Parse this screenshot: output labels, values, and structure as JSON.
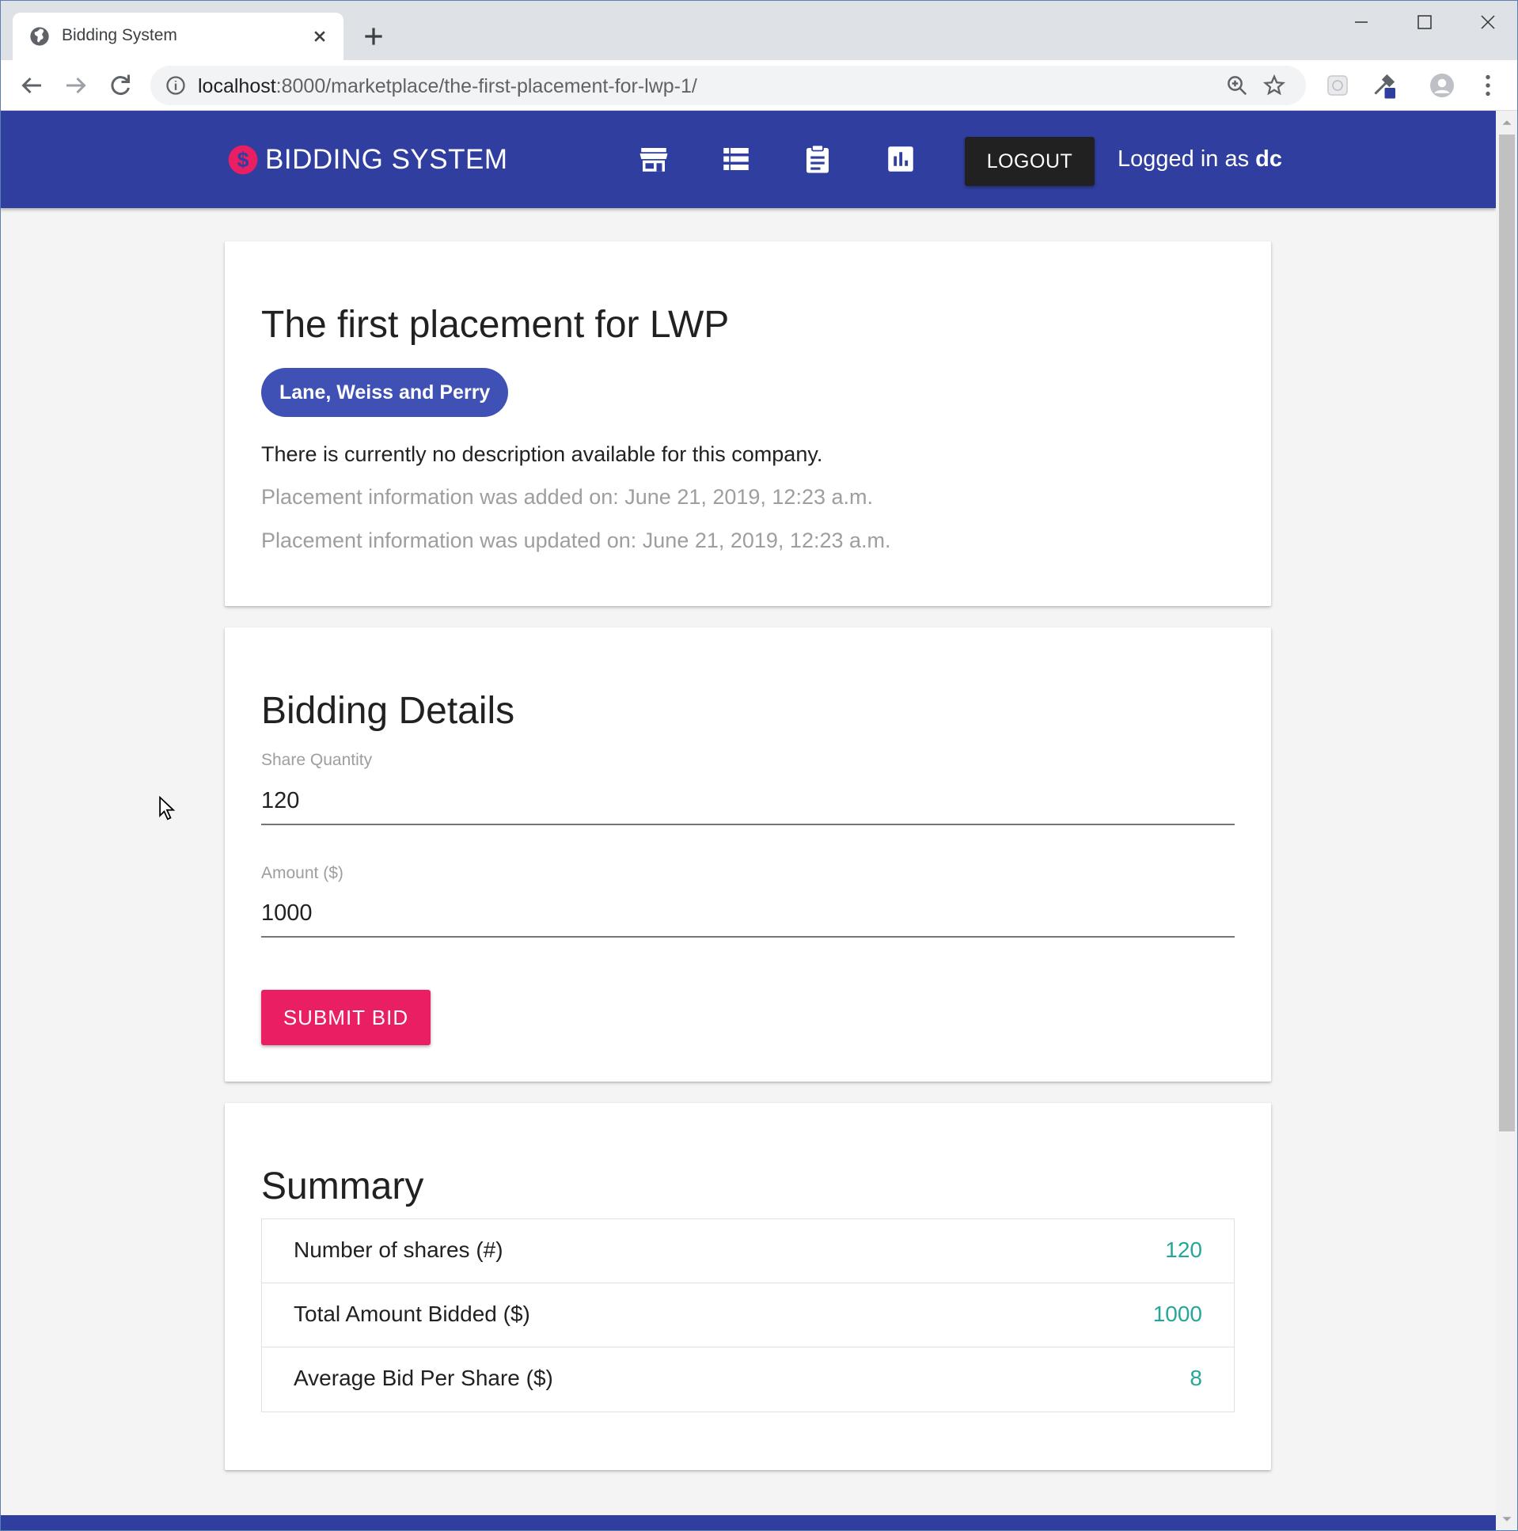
{
  "browser": {
    "tab_title": "Bidding System",
    "url_host": "localhost",
    "url_path": ":8000/marketplace/the-first-placement-for-lwp-1/"
  },
  "navbar": {
    "brand": "BIDDING SYSTEM",
    "logout_label": "LOGOUT",
    "logged_in_prefix": "Logged in as ",
    "username": "dc"
  },
  "placement": {
    "title": "The first placement for LWP",
    "company": "Lane, Weiss and Perry",
    "description": "There is currently no description available for this company.",
    "added": "Placement information was added on: June 21, 2019, 12:23 a.m.",
    "updated": "Placement information was updated on: June 21, 2019, 12:23 a.m."
  },
  "bidding": {
    "title": "Bidding Details",
    "share_label": "Share Quantity",
    "share_value": "120",
    "amount_label": "Amount ($)",
    "amount_value": "1000",
    "submit_label": "SUBMIT BID"
  },
  "summary": {
    "title": "Summary",
    "rows": [
      {
        "label": "Number of shares (#)",
        "value": "120"
      },
      {
        "label": "Total Amount Bidded ($)",
        "value": "1000"
      },
      {
        "label": "Average Bid Per Share ($)",
        "value": "8"
      }
    ]
  },
  "colors": {
    "navbar": "#303f9f",
    "chip": "#3f51b5",
    "accent": "#e91e63",
    "summary_value": "#26a69a"
  }
}
